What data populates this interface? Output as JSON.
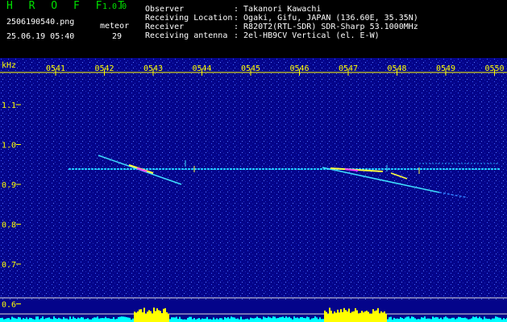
{
  "header": {
    "title": "H R O F F T",
    "version": "1.0.0",
    "filename": "2506190540.png",
    "datetime": "25.06.19 05:40",
    "meteor_label": "meteor",
    "meteor_count": "29",
    "info": [
      {
        "label": "Observer",
        "value": ": Takanori Kawachi"
      },
      {
        "label": "Receiving Location",
        "value": ": Ogaki, Gifu, JAPAN (136.60E, 35.35N)"
      },
      {
        "label": "Receiver",
        "value": ": R820T2(RTL-SDR) SDR-Sharp 53.1000MHz"
      },
      {
        "label": "Receiving antenna",
        "value": ": 2el-HB9CV Vertical (el. E-W)"
      }
    ]
  },
  "spectrogram": {
    "unit_label": "kHz",
    "time_ticks": [
      "0541",
      "0542",
      "0543",
      "0544",
      "0545",
      "0546",
      "0547",
      "0548",
      "0549",
      "0550"
    ],
    "freq_ticks": [
      "1.1",
      "1.0",
      "0.9",
      "0.8",
      "0.7",
      "0.6"
    ],
    "colors": {
      "background": "#04048a",
      "carrier": "#00e0ff",
      "echo": "#ffff00",
      "hot": "#ff40ff",
      "axis": "#ffff00",
      "signal": "#00ffff",
      "meteor_bar": "#ffff00"
    }
  }
}
